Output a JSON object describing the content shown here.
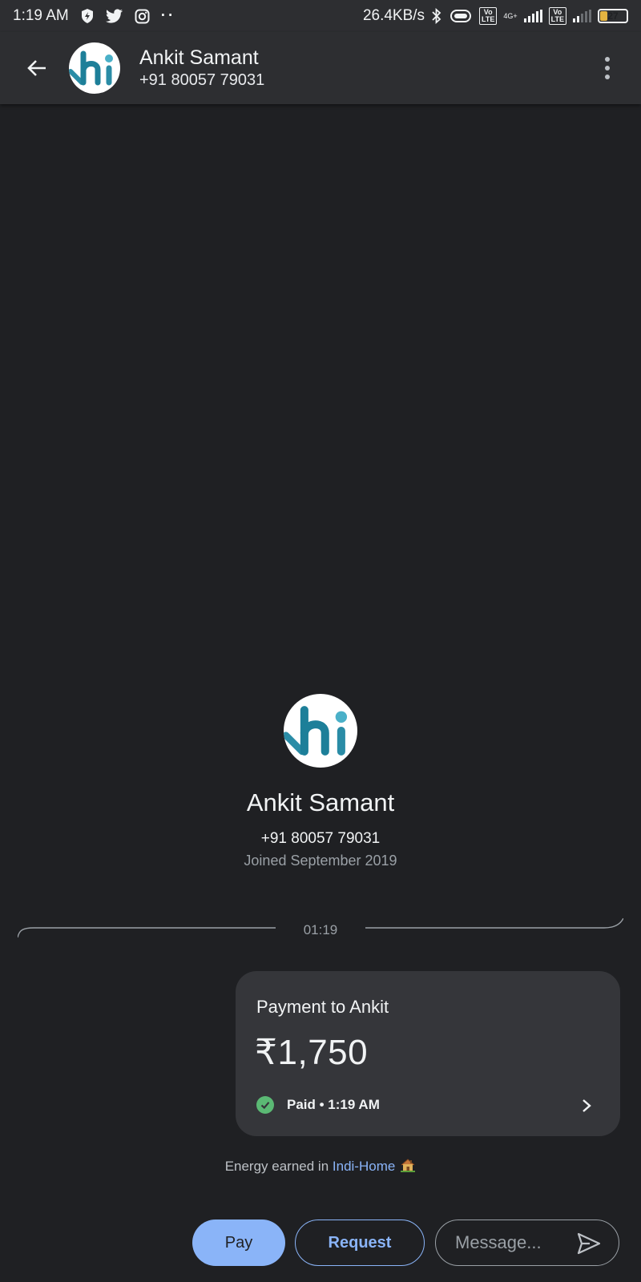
{
  "status_bar": {
    "time": "1:19 AM",
    "network_speed": "26.4KB/s",
    "network_type": "4G+",
    "lte_label": "Vo LTE",
    "battery_level": "27",
    "icons": [
      "shield-bolt-icon",
      "twitter-icon",
      "instagram-icon",
      "more-dots-icon",
      "bluetooth-icon",
      "vibrate-icon",
      "signal-icon",
      "battery-icon"
    ]
  },
  "header": {
    "contact_name": "Ankit Samant",
    "contact_phone": "+91 80057 79031",
    "avatar_text": "hi"
  },
  "profile": {
    "name": "Ankit Samant",
    "phone": "+91 80057 79031",
    "joined": "Joined September 2019",
    "avatar_text": "hi"
  },
  "conversation": {
    "timestamp": "01:19",
    "payment": {
      "title": "Payment to Ankit",
      "amount": "₹1,750",
      "status": "Paid • 1:19 AM"
    },
    "energy_note": {
      "prefix": "Energy earned in ",
      "link": "Indi-Home"
    }
  },
  "bottom_bar": {
    "pay_label": "Pay",
    "request_label": "Request",
    "message_placeholder": "Message..."
  },
  "colors": {
    "background": "#1f2023",
    "header": "#2d2e31",
    "card": "#35363a",
    "accent": "#8ab4f8",
    "paid_green": "#5bb974"
  }
}
